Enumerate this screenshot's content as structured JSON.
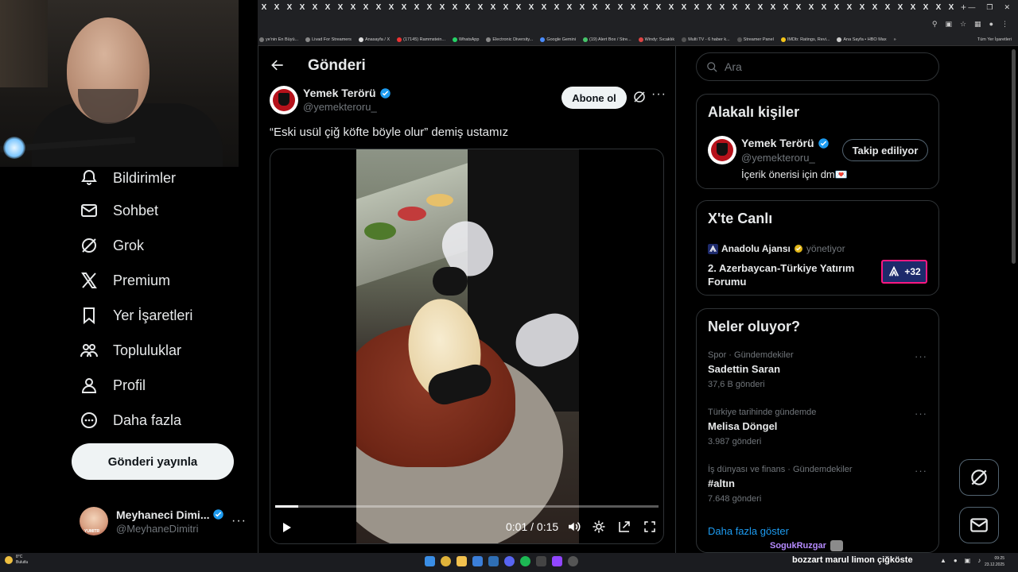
{
  "browser": {
    "tab_glyphs": [
      "X",
      "X",
      "X",
      "X",
      "X",
      "X",
      "X",
      "X",
      "X",
      "X",
      "X",
      "X",
      "X",
      "X",
      "X",
      "X",
      "X",
      "X",
      "X",
      "X",
      "X",
      "X",
      "X",
      "X",
      "X",
      "X",
      "X",
      "X",
      "X",
      "X",
      "X",
      "X",
      "X",
      "X",
      "X",
      "X",
      "X",
      "X",
      "X",
      "X",
      "X",
      "X",
      "X",
      "X",
      "X",
      "X",
      "X",
      "X",
      "X",
      "X",
      "X",
      "X",
      "X",
      "X",
      "X"
    ],
    "new_tab": "+",
    "bookmarks": [
      "ye'nin En Büyü...",
      "Livad For Streamers",
      "Anasayfa / X",
      "(17145) Rammstein...",
      "WhatsApp",
      "Electronic Diversity...",
      "Google Gemini",
      "(19) Alert Box / Stre...",
      "Windy: Sıcaklık",
      "Multi TV - 6 haber k...",
      "Streamer Panel",
      "IMDb: Ratings, Revi...",
      "Ana Sayfa • HBO Max"
    ],
    "bookmarks_more": "»",
    "bookmarks_right": "Tüm Yer İşaretleri"
  },
  "nav": {
    "items": [
      {
        "label": "Bildirimler",
        "icon": "bell-icon"
      },
      {
        "label": "Sohbet",
        "icon": "mail-icon"
      },
      {
        "label": "Grok",
        "icon": "grok-icon"
      },
      {
        "label": "Premium",
        "icon": "x-logo-icon"
      },
      {
        "label": "Yer İşaretleri",
        "icon": "bookmark-icon"
      },
      {
        "label": "Topluluklar",
        "icon": "people-icon"
      },
      {
        "label": "Profil",
        "icon": "person-icon"
      },
      {
        "label": "Daha fazla",
        "icon": "more-circle-icon"
      }
    ],
    "post_button": "Gönderi yayınla",
    "account": {
      "name": "Meyhaneci Dimi...",
      "handle": "@MeyhaneDimitri",
      "more": "···"
    }
  },
  "post": {
    "page_title": "Gönderi",
    "author_name": "Yemek Terörü",
    "author_handle": "@yemekteroru_",
    "subscribe_label": "Abone ol",
    "more": "···",
    "text": "“Eski usül çiğ köfte böyle olur” demiş ustamız",
    "video": {
      "current_time": "0:01",
      "separator": "/",
      "duration": "0:15",
      "progress": 0.06
    }
  },
  "right": {
    "search_placeholder": "Ara",
    "related": {
      "title": "Alakalı kişiler",
      "name": "Yemek Terörü",
      "handle": "@yemekteroru_",
      "bio": "İçerik önerisi için dm💌",
      "follow_label": "Takip ediliyor"
    },
    "live": {
      "title": "X'te Canlı",
      "source": "Anadolu Ajansı",
      "source_role": "yönetiyor",
      "event": "2. Azerbaycan-Türkiye Yatırım Forumu",
      "badge": "+32"
    },
    "trends": {
      "title": "Neler oluyor?",
      "items": [
        {
          "meta": "Spor · Gündemdekiler",
          "name": "Sadettin Saran",
          "count": "37,6 B gönderi"
        },
        {
          "meta": "Türkiye tarihinde gündemde",
          "name": "Melisa Döngel",
          "count": "3.987 gönderi"
        },
        {
          "meta": "İş dünyası ve finans · Gündemdekiler",
          "name": "#altın",
          "count": "7.648 gönderi"
        }
      ],
      "more_dots": "···",
      "show_more": "Daha fazla göster"
    }
  },
  "overlay": {
    "chat_user": "SogukRuzgar",
    "chat_line": "bozzart  marul limon çiğköste"
  },
  "taskbar": {
    "weather_temp": "8°C",
    "weather_desc": "Bulutlu",
    "time": "09:25",
    "date": "23.12.2025"
  },
  "colors": {
    "accent": "#1d9bf0",
    "verified": "#1d9bf0",
    "gold_badge": "#e2b719",
    "live_border": "#f91880",
    "background": "#000000"
  }
}
